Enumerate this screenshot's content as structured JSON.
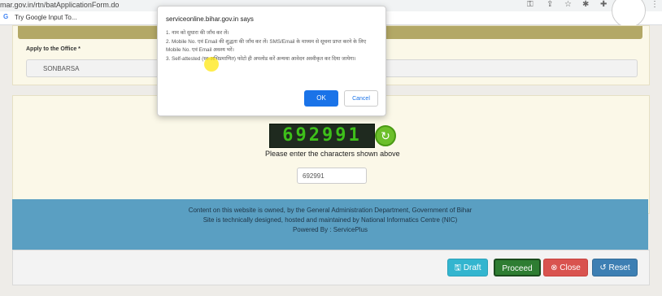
{
  "browser": {
    "url_fragment": "mar.gov.in/rtn/batApplicationForm.do",
    "bookmark_label": "Try Google Input To..."
  },
  "form": {
    "office_label": "Apply to the Office *",
    "office_value": "SONBARSA"
  },
  "captcha": {
    "code": "692991",
    "hint": "Please enter the characters shown above",
    "input_value": "692991"
  },
  "footer": {
    "line1": "Content on this website is owned, by the General Administration Department, Government of Bihar",
    "line2": "Site is technically designed, hosted and maintained by National Informatics Centre (NIC)",
    "line3": "Powered By : ServicePlus"
  },
  "actions": {
    "draft_label": "Draft",
    "proceed_label": "Proceed",
    "close_label": "Close",
    "reset_label": "Reset"
  },
  "dialog": {
    "title": "serviceonline.bihar.gov.in says",
    "lines": [
      "1. नाम को सुधारा की जाँच कर लें।",
      "2. Mobile No. एवं Email की शुद्धता की जाँच कर लें। SMS/Email के माध्यम से सूचना प्राप्त करने के लिए Mobile No. एवं Email अवश्य भरें।",
      "3. Self-attested (स्व-अभिप्रमाणित) फोटो ही अपलोड करें अन्यथा आवेदन अस्वीकृत कर दिया जायेगा।"
    ],
    "ok_label": "OK",
    "cancel_label": "Cancel"
  },
  "colors": {
    "footer": "#5a9fc2",
    "proceed": "#2e7d32",
    "close": "#d9534f",
    "draft": "#33b5cf",
    "reset": "#3d7fb3"
  }
}
